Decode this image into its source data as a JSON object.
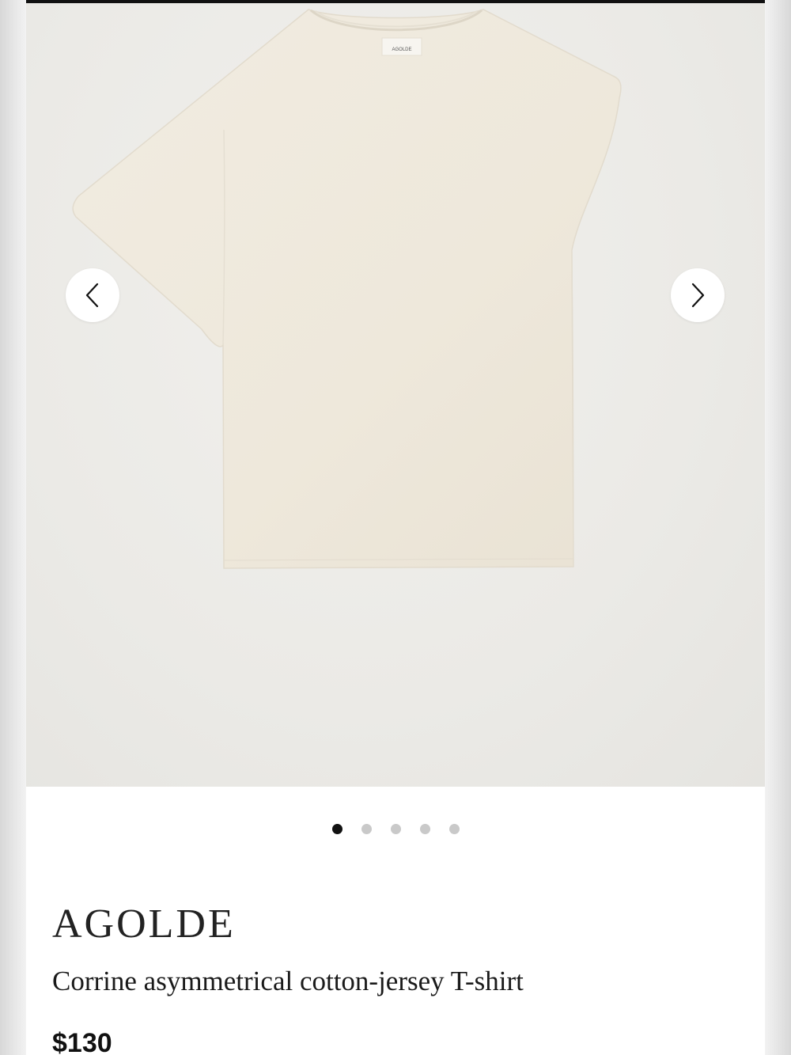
{
  "gallery": {
    "prev_icon": "chevron-left-icon",
    "next_icon": "chevron-right-icon",
    "slide_count": 5,
    "active_slide": 1,
    "label_text": "AGOLDE"
  },
  "product": {
    "brand": "AGOLDE",
    "name": "Corrine asymmetrical cotton-jersey T-shirt",
    "price": "$130"
  },
  "colors": {
    "page_background": "#ffffff",
    "gallery_background": "#ebeae6",
    "garment_color": "#efe9dd",
    "active_dot": "#111111",
    "inactive_dot": "#c9c9c9"
  }
}
